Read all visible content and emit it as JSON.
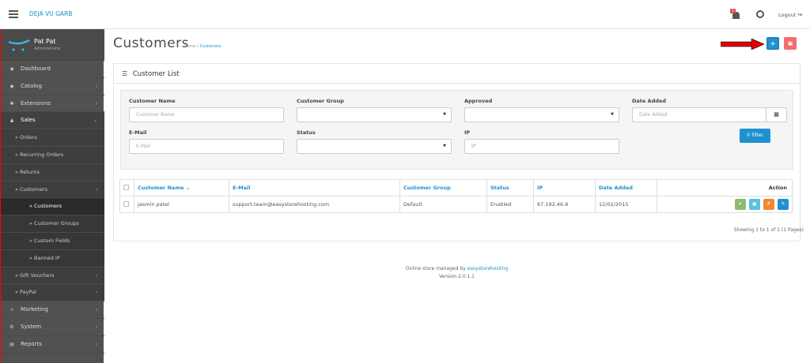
{
  "app": {
    "brand": "DEJA VU GARB",
    "logout_label": "Logout",
    "notification_count": "5"
  },
  "profile": {
    "name": "Pat Pat",
    "role": "Administrator"
  },
  "nav": [
    {
      "label": "Dashboard",
      "icon": "dashboard-icon"
    },
    {
      "label": "Catalog",
      "icon": "tag-icon"
    },
    {
      "label": "Extensions",
      "icon": "puzzle-icon"
    },
    {
      "label": "Sales",
      "icon": "cart-icon"
    },
    {
      "label": "Orders"
    },
    {
      "label": "Recurring Orders"
    },
    {
      "label": "Returns"
    },
    {
      "label": "Customers"
    },
    {
      "label": "Customers"
    },
    {
      "label": "Customer Groups"
    },
    {
      "label": "Custom Fields"
    },
    {
      "label": "Banned IP"
    },
    {
      "label": "Gift Vouchers"
    },
    {
      "label": "PayPal"
    },
    {
      "label": "Marketing",
      "icon": "share-icon"
    },
    {
      "label": "System",
      "icon": "cog-icon"
    },
    {
      "label": "Reports",
      "icon": "bar-chart-icon"
    }
  ],
  "page": {
    "title": "Customers",
    "breadcrumb_home": "Home",
    "breadcrumb_sep": "/",
    "breadcrumb_current": "Customers"
  },
  "panel": {
    "title": "Customer List"
  },
  "filter": {
    "customer_name_label": "Customer Name",
    "customer_name_placeholder": "Customer Name",
    "customer_group_label": "Customer Group",
    "approved_label": "Approved",
    "date_added_label": "Date Added",
    "date_added_placeholder": "Date Added",
    "email_label": "E-Mail",
    "email_placeholder": "E-Mail",
    "status_label": "Status",
    "ip_label": "IP",
    "ip_placeholder": "IP",
    "filter_button": "Filter"
  },
  "table": {
    "headers": [
      "Customer Name",
      "E-Mail",
      "Customer Group",
      "Status",
      "IP",
      "Date Added",
      "Action"
    ],
    "sort_indicator": "⌄",
    "rows": [
      [
        "jasmin patel",
        "support.team@easystorehosting.com",
        "Default",
        "Enabled",
        "67.192.46.8",
        "12/02/2015"
      ]
    ]
  },
  "pagination": {
    "summary": "Showing 1 to 1 of 1 (1 Pages)"
  },
  "footer": {
    "line1_prefix": "Online store managed by",
    "line1_link": "easystorehosting",
    "line2": "Version 2.0.1.1"
  },
  "colors": {
    "primary": "#1e91cf",
    "danger": "#f56b6b",
    "success": "#8fbb6c",
    "info": "#5bc0de",
    "warning": "#f38733",
    "sidebar": "#515151",
    "annotation_arrow": "#e00000"
  }
}
